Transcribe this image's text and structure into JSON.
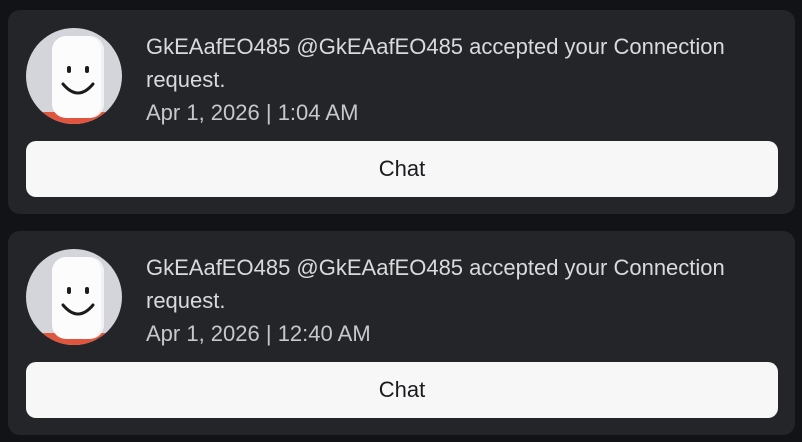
{
  "notifications": [
    {
      "message": "GkEAafEO485 @GkEAafEO485 accepted your Connection request.",
      "timestamp": "Apr 1, 2026 | 1:04 AM",
      "action_label": "Chat",
      "avatar_icon": "default-avatar-smiley-icon"
    },
    {
      "message": "GkEAafEO485 @GkEAafEO485 accepted your Connection request.",
      "timestamp": "Apr 1, 2026 | 12:40 AM",
      "action_label": "Chat",
      "avatar_icon": "default-avatar-smiley-icon"
    }
  ],
  "colors": {
    "background": "#121316",
    "card": "#232529",
    "button": "#f7f7f8",
    "text_primary": "#d9dadc",
    "avatar_shirt": "#e0553e"
  }
}
